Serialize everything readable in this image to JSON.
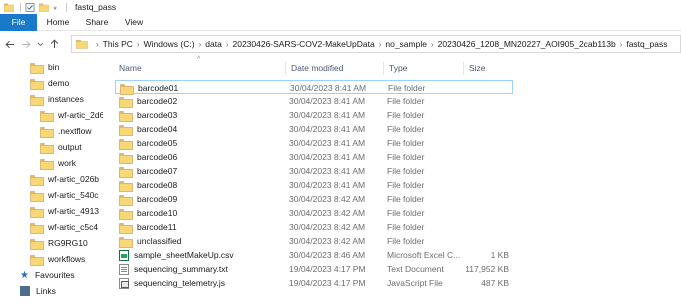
{
  "window": {
    "title": "fastq_pass"
  },
  "ribbon": {
    "tabs": [
      "File",
      "Home",
      "Share",
      "View"
    ]
  },
  "address": {
    "crumbs": [
      "This PC",
      "Windows (C:)",
      "data",
      "20230426-SARS-COV2-MakeUpData",
      "no_sample",
      "20230426_1208_MN20227_AOI905_2cab113b",
      "fastq_pass"
    ]
  },
  "nav": {
    "items": [
      {
        "label": "bin",
        "icon": "folder-icon"
      },
      {
        "label": "demo",
        "icon": "folder-icon"
      },
      {
        "label": "instances",
        "icon": "folder-icon"
      },
      {
        "label": "wf-artic_2d6c",
        "icon": "folder-icon"
      },
      {
        "label": ".nextflow",
        "icon": "folder-icon"
      },
      {
        "label": "output",
        "icon": "folder-icon"
      },
      {
        "label": "work",
        "icon": "folder-icon"
      },
      {
        "label": "wf-artic_026b",
        "icon": "folder-icon"
      },
      {
        "label": "wf-artic_540c",
        "icon": "folder-icon"
      },
      {
        "label": "wf-artic_4913",
        "icon": "folder-icon"
      },
      {
        "label": "wf-artic_c5c4",
        "icon": "folder-icon"
      },
      {
        "label": "RG9RG10",
        "icon": "folder-icon"
      },
      {
        "label": "workflows",
        "icon": "folder-icon"
      },
      {
        "label": "Favourites",
        "icon": "star-icon"
      },
      {
        "label": "Links",
        "icon": "links-icon"
      }
    ]
  },
  "columns": {
    "name": "Name",
    "date": "Date modified",
    "type": "Type",
    "size": "Size"
  },
  "files": [
    {
      "name": "barcode01",
      "date": "30/04/2023 8:41 AM",
      "type": "File folder",
      "size": "",
      "icon": "folder-icon"
    },
    {
      "name": "barcode02",
      "date": "30/04/2023 8:41 AM",
      "type": "File folder",
      "size": "",
      "icon": "folder-icon"
    },
    {
      "name": "barcode03",
      "date": "30/04/2023 8:41 AM",
      "type": "File folder",
      "size": "",
      "icon": "folder-icon"
    },
    {
      "name": "barcode04",
      "date": "30/04/2023 8:41 AM",
      "type": "File folder",
      "size": "",
      "icon": "folder-icon"
    },
    {
      "name": "barcode05",
      "date": "30/04/2023 8:41 AM",
      "type": "File folder",
      "size": "",
      "icon": "folder-icon"
    },
    {
      "name": "barcode06",
      "date": "30/04/2023 8:41 AM",
      "type": "File folder",
      "size": "",
      "icon": "folder-icon"
    },
    {
      "name": "barcode07",
      "date": "30/04/2023 8:41 AM",
      "type": "File folder",
      "size": "",
      "icon": "folder-icon"
    },
    {
      "name": "barcode08",
      "date": "30/04/2023 8:41 AM",
      "type": "File folder",
      "size": "",
      "icon": "folder-icon"
    },
    {
      "name": "barcode09",
      "date": "30/04/2023 8:42 AM",
      "type": "File folder",
      "size": "",
      "icon": "folder-icon"
    },
    {
      "name": "barcode10",
      "date": "30/04/2023 8:42 AM",
      "type": "File folder",
      "size": "",
      "icon": "folder-icon"
    },
    {
      "name": "barcode11",
      "date": "30/04/2023 8:42 AM",
      "type": "File folder",
      "size": "",
      "icon": "folder-icon"
    },
    {
      "name": "unclassified",
      "date": "30/04/2023 8:42 AM",
      "type": "File folder",
      "size": "",
      "icon": "folder-icon"
    },
    {
      "name": "sample_sheetMakeUp.csv",
      "date": "30/04/2023 8:46 AM",
      "type": "Microsoft Excel C...",
      "size": "1 KB",
      "icon": "csv-file-icon"
    },
    {
      "name": "sequencing_summary.txt",
      "date": "19/04/2023 4:17 PM",
      "type": "Text Document",
      "size": "117,952 KB",
      "icon": "text-file-icon"
    },
    {
      "name": "sequencing_telemetry.js",
      "date": "19/04/2023 4:17 PM",
      "type": "JavaScript File",
      "size": "487 KB",
      "icon": "js-file-icon"
    }
  ]
}
